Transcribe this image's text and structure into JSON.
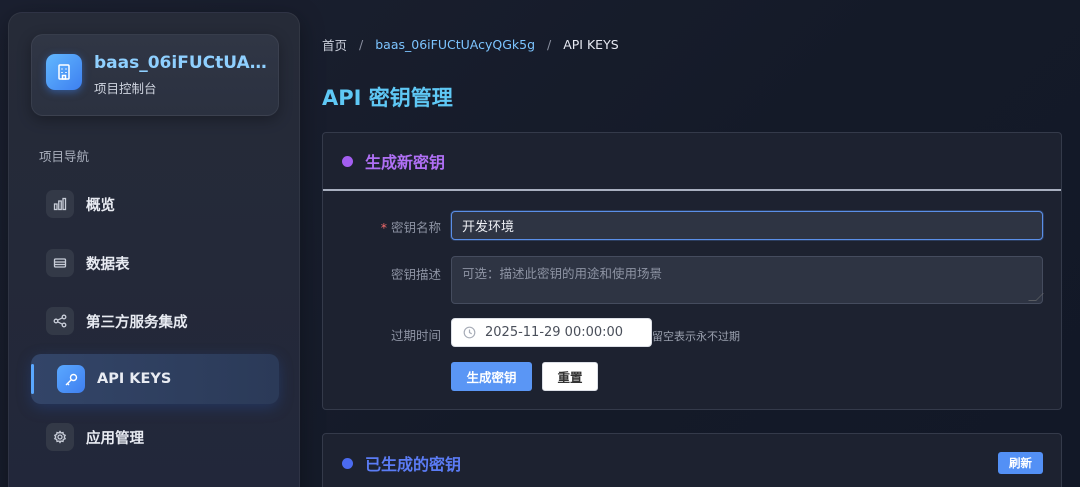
{
  "sidebar": {
    "project_name": "baas_06iFUCtUAcyQGk5g",
    "project_sub": "项目控制台",
    "nav_title": "项目导航",
    "items": [
      {
        "label": "概览",
        "icon": "bar-chart-icon"
      },
      {
        "label": "数据表",
        "icon": "table-icon"
      },
      {
        "label": "第三方服务集成",
        "icon": "share-icon"
      },
      {
        "label": "API KEYS",
        "icon": "key-icon",
        "active": true
      },
      {
        "label": "应用管理",
        "icon": "gear-icon"
      }
    ]
  },
  "breadcrumb": {
    "home": "首页",
    "project": "baas_06iFUCtUAcyQGk5g",
    "current": "API KEYS"
  },
  "page": {
    "title": "API 密钥管理"
  },
  "create_panel": {
    "title": "生成新密钥",
    "name_label": "密钥名称",
    "name_value": "开发环境",
    "desc_label": "密钥描述",
    "desc_placeholder": "可选：描述此密钥的用途和使用场景",
    "expire_label": "过期时间",
    "expire_value": "2025-11-29 00:00:00",
    "expire_hint": "留空表示永不过期",
    "generate_label": "生成密钥",
    "reset_label": "重置"
  },
  "list_panel": {
    "title": "已生成的密钥",
    "refresh_label": "刷新"
  },
  "colors": {
    "accent": "#5a96f5",
    "title": "#5fc8f5",
    "purple": "#b070f5"
  }
}
